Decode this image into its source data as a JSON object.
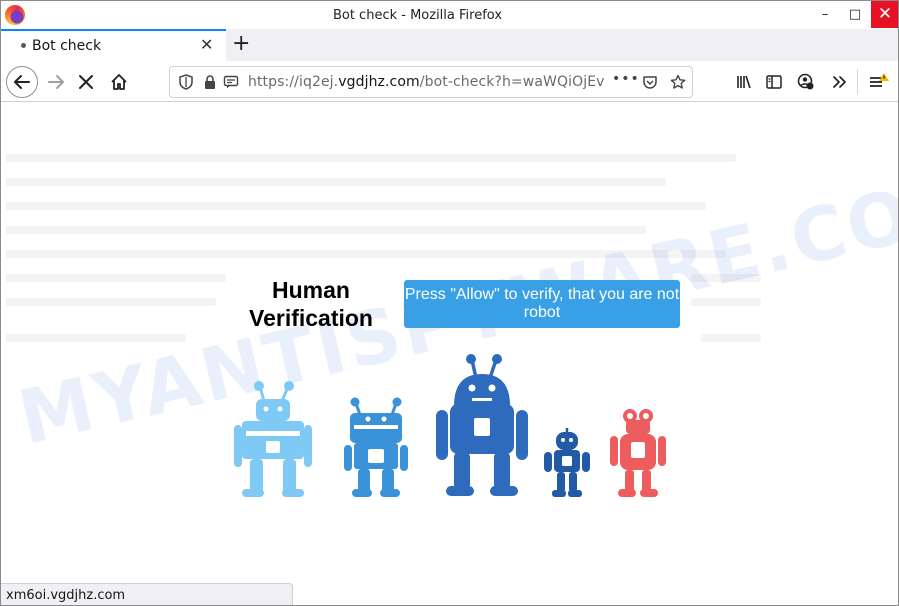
{
  "window": {
    "title": "Bot check - Mozilla Firefox",
    "controls": {
      "minimize": "–",
      "maximize": "□",
      "close": "✕"
    }
  },
  "tab": {
    "title": "Bot check",
    "close": "✕",
    "new_tab": "+"
  },
  "urlbar": {
    "scheme": "https://iq2ej.",
    "host": "vgdjhz.com",
    "path": "/bot-check?h=waWQiOjEv",
    "more": "•••"
  },
  "page": {
    "heading": "Human Verification",
    "allow_message": "Press \"Allow\" to verify, that you are not robot",
    "watermark": "MYANTISPYWARE.COM",
    "robot_colors": [
      "#7fc9f5",
      "#3a93d8",
      "#2e6bbd",
      "#225aa6",
      "#ee5d5d"
    ]
  },
  "status": {
    "link": "xm6oi.vgdjhz.com"
  },
  "colors": {
    "accent": "#0a84ff",
    "button": "#3aa0e6",
    "close": "#e81123"
  }
}
